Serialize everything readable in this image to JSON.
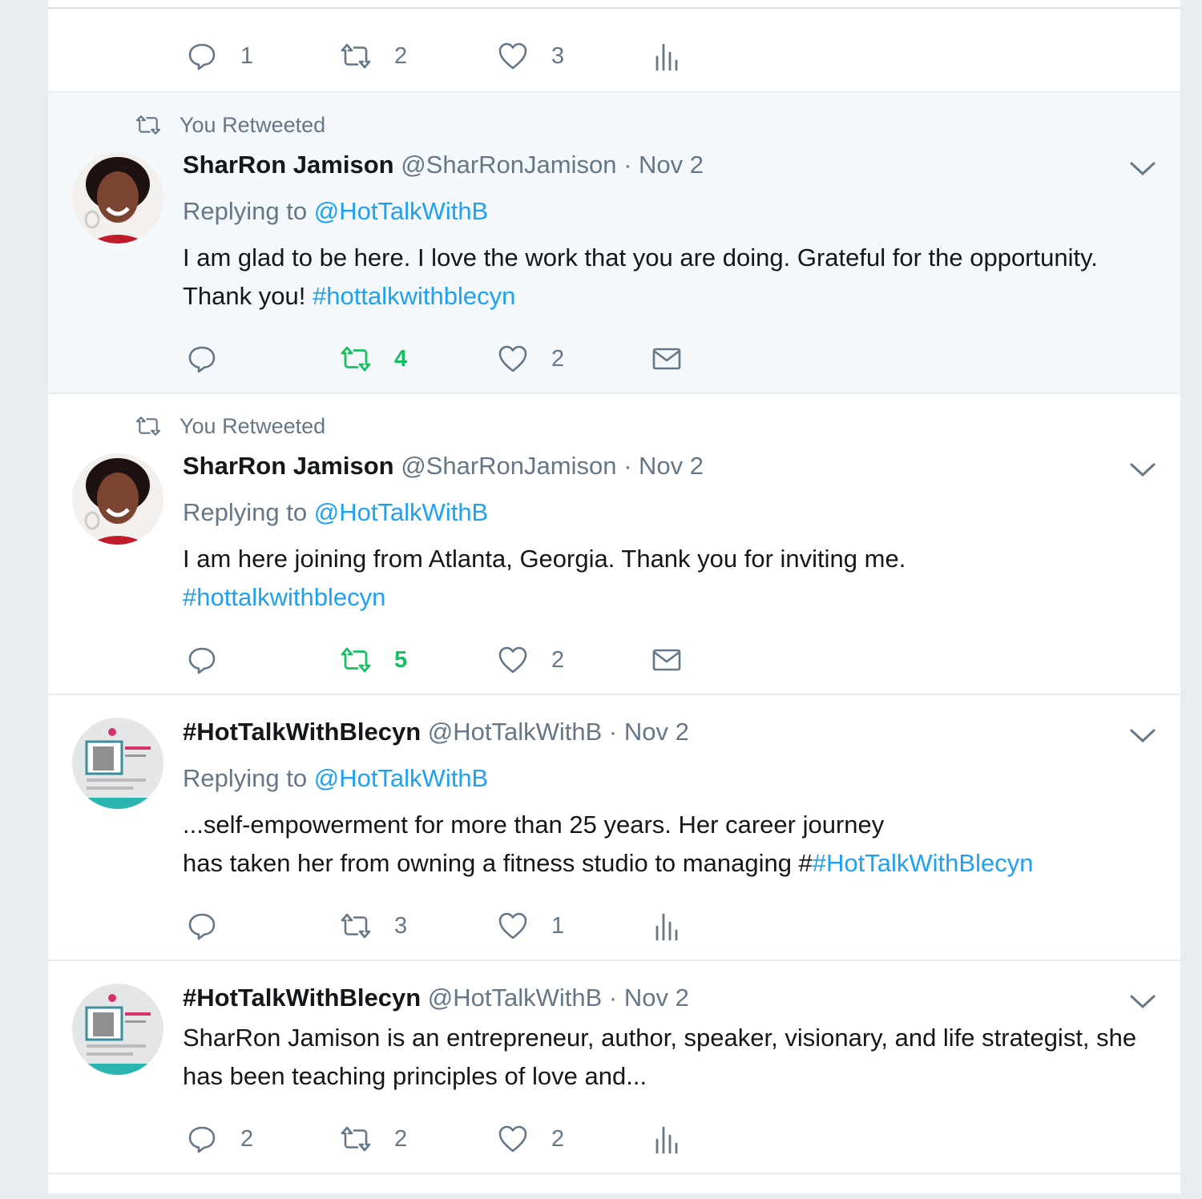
{
  "colors": {
    "link": "#1da1f2",
    "muted": "#657786",
    "text": "#14171a",
    "retweet_active": "#17bf63"
  },
  "top_fragment": {
    "reply": "1",
    "retweet": "2",
    "like": "3"
  },
  "tweets": [
    {
      "retweeted_label": "You Retweeted",
      "name": "SharRon Jamison",
      "handle": "@SharRonJamison",
      "date": "· Nov 2",
      "replying_prefix": "Replying to",
      "replying_to": "@HotTalkWithB",
      "text": "I am glad to be here. I love the work that you are doing. Grateful for the opportunity. Thank you!",
      "hashtag": "#hottalkwithblecyn",
      "reply": "",
      "retweet": "4",
      "like": "2"
    },
    {
      "retweeted_label": "You Retweeted",
      "name": "SharRon Jamison",
      "handle": "@SharRonJamison",
      "date": "· Nov 2",
      "replying_prefix": "Replying to",
      "replying_to": "@HotTalkWithB",
      "text": "I am here joining from Atlanta, Georgia. Thank you for inviting me.",
      "hashtag": "#hottalkwithblecyn",
      "reply": "",
      "retweet": "5",
      "like": "2"
    },
    {
      "name": "#HotTalkWithBlecyn",
      "handle": "@HotTalkWithB",
      "date": "· Nov 2",
      "replying_prefix": "Replying to",
      "replying_to": "@HotTalkWithB",
      "text_line1": "...self-empowerment for more than 25 years. Her career journey",
      "text_line2": "has taken her from owning a fitness studio to managing #",
      "hashtag": "#HotTalkWithBlecyn",
      "reply": "",
      "retweet": "3",
      "like": "1"
    },
    {
      "name": "#HotTalkWithBlecyn",
      "handle": "@HotTalkWithB",
      "date": "· Nov 2",
      "text": "SharRon Jamison is an entrepreneur, author, speaker, visionary, and life strategist, she has been teaching principles of love and...",
      "reply": "2",
      "retweet": "2",
      "like": "2"
    }
  ]
}
